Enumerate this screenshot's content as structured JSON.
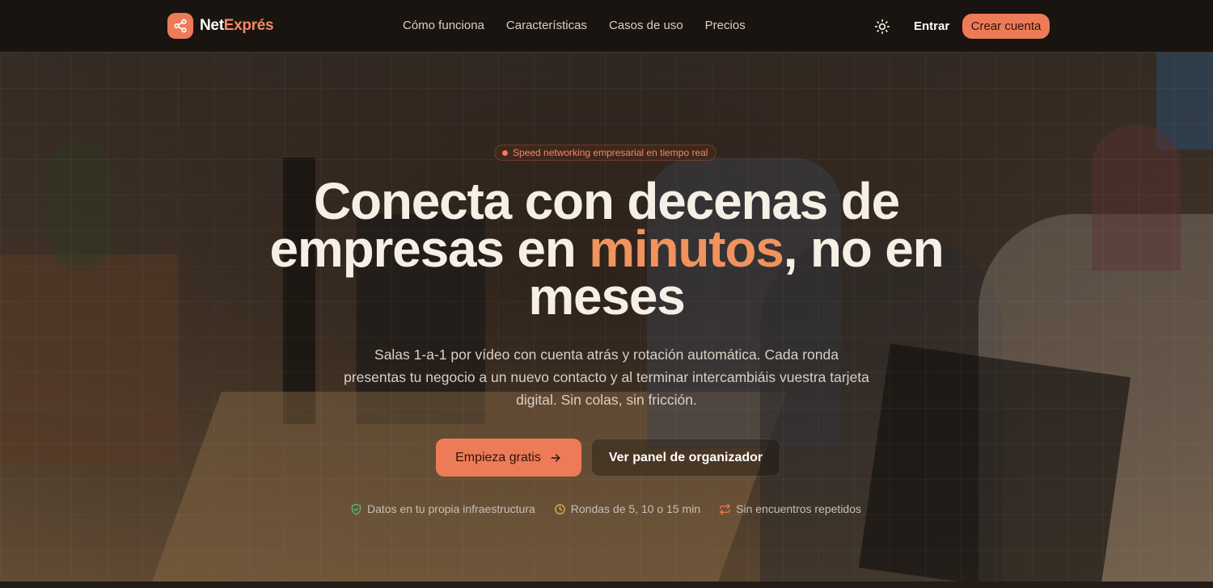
{
  "brand": {
    "name_part1": "Net",
    "name_part2": "Exprés",
    "logo_icon": "share-icon"
  },
  "nav": {
    "items": [
      {
        "label": "Cómo funciona"
      },
      {
        "label": "Características"
      },
      {
        "label": "Casos de uso"
      },
      {
        "label": "Precios"
      }
    ]
  },
  "header": {
    "theme_icon": "sun-icon",
    "login_label": "Entrar",
    "signup_label": "Crear cuenta"
  },
  "hero": {
    "badge": "Speed networking empresarial en tiempo real",
    "headline_part1": "Conecta con decenas de empresas en ",
    "headline_accent": "minutos",
    "headline_part2": ", no en meses",
    "subtitle": "Salas 1-a-1 por vídeo con cuenta atrás y rotación automática. Cada ronda presentas tu negocio a un nuevo contacto y al terminar intercambiáis vuestra tarjeta digital. Sin colas, sin fricción.",
    "cta_primary": "Empieza gratis",
    "cta_primary_icon": "arrow-right-icon",
    "cta_secondary": "Ver panel de organizador",
    "features": [
      {
        "icon": "shield-check-icon",
        "label": "Datos en tu propia infraestructura"
      },
      {
        "icon": "clock-icon",
        "label": "Rondas de 5, 10 o 15 min"
      },
      {
        "icon": "repeat-icon",
        "label": "Sin encuentros repetidos"
      }
    ]
  },
  "colors": {
    "accent": "#ee7b57",
    "accent_text": "#f0935e",
    "header_bg": "#1a1411"
  }
}
